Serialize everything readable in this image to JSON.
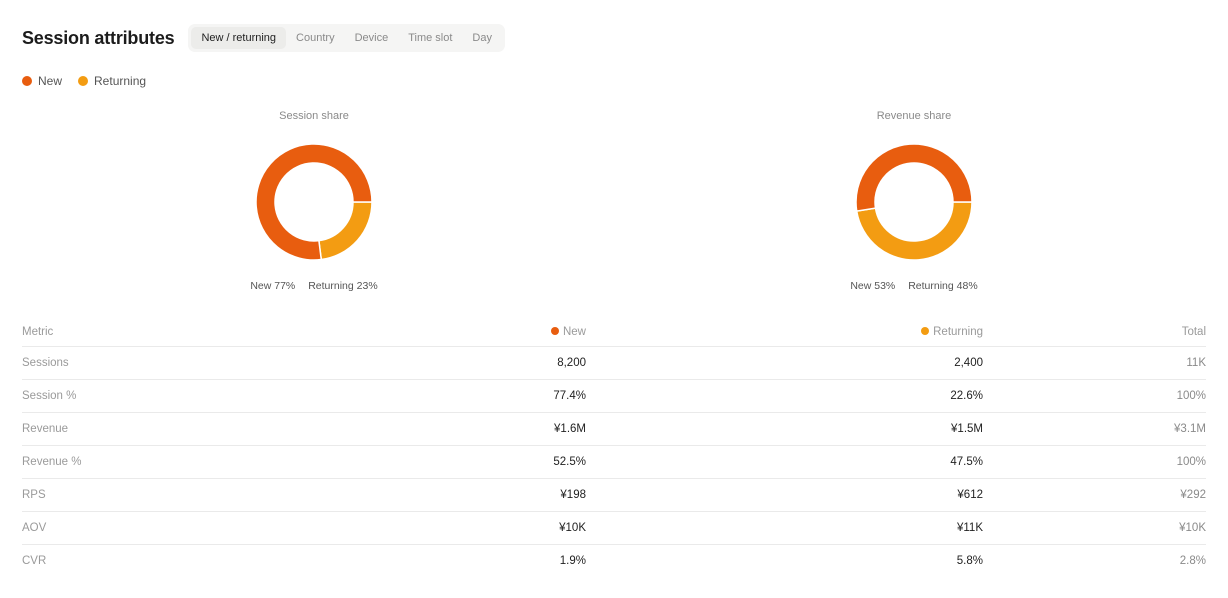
{
  "header": {
    "title": "Session attributes",
    "tabs": [
      {
        "label": "New / returning",
        "active": true
      },
      {
        "label": "Country",
        "active": false
      },
      {
        "label": "Device",
        "active": false
      },
      {
        "label": "Time slot",
        "active": false
      },
      {
        "label": "Day",
        "active": false
      }
    ]
  },
  "colors": {
    "new": "#e85d0f",
    "returning": "#f39c12"
  },
  "legend": {
    "new": "New",
    "returning": "Returning"
  },
  "charts": {
    "session": {
      "title": "Session share",
      "new_label": "New 77%",
      "returning_label": "Returning 23%"
    },
    "revenue": {
      "title": "Revenue share",
      "new_label": "New 53%",
      "returning_label": "Returning 48%"
    }
  },
  "chart_data": [
    {
      "type": "pie",
      "title": "Session share",
      "categories": [
        "New",
        "Returning"
      ],
      "values": [
        77,
        23
      ]
    },
    {
      "type": "pie",
      "title": "Revenue share",
      "categories": [
        "New",
        "Returning"
      ],
      "values": [
        52.5,
        47.5
      ]
    }
  ],
  "table": {
    "headers": {
      "metric": "Metric",
      "new": "New",
      "returning": "Returning",
      "total": "Total"
    },
    "rows": [
      {
        "metric": "Sessions",
        "new": "8,200",
        "returning": "2,400",
        "total": "11K"
      },
      {
        "metric": "Session %",
        "new": "77.4%",
        "returning": "22.6%",
        "total": "100%"
      },
      {
        "metric": "Revenue",
        "new": "¥1.6M",
        "returning": "¥1.5M",
        "total": "¥3.1M"
      },
      {
        "metric": "Revenue %",
        "new": "52.5%",
        "returning": "47.5%",
        "total": "100%"
      },
      {
        "metric": "RPS",
        "new": "¥198",
        "returning": "¥612",
        "total": "¥292"
      },
      {
        "metric": "AOV",
        "new": "¥10K",
        "returning": "¥11K",
        "total": "¥10K"
      },
      {
        "metric": "CVR",
        "new": "1.9%",
        "returning": "5.8%",
        "total": "2.8%"
      }
    ]
  }
}
